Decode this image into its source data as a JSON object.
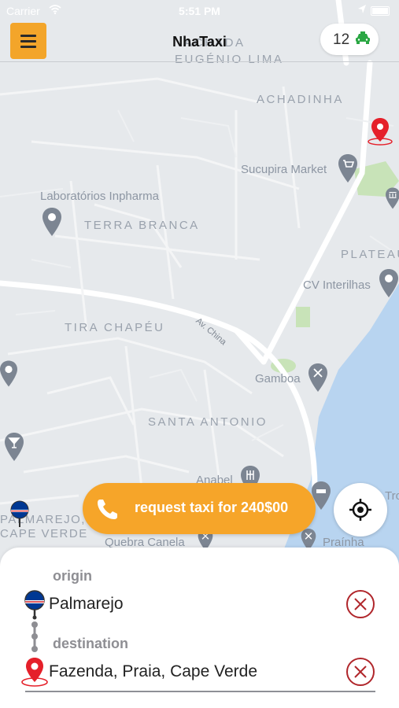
{
  "status_bar": {
    "carrier": "Carrier",
    "time": "5:51 PM"
  },
  "header": {
    "title": "NhaTaxi",
    "taxi_count": "12"
  },
  "map": {
    "district_labels": [
      "ACHADA",
      "EUGÉNIO LIMA",
      "ACHADINHA",
      "TERRA BRANCA",
      "PLATEAU",
      "TIRA CHAPÉU",
      "SANTA ANTONIO",
      "PALMAREJO,",
      "CAPE VERDE"
    ],
    "poi_labels": [
      "Sucupira Market",
      "Laboratórios Inpharma",
      "CV Interilhas",
      "Gamboa",
      "Anabel",
      "Quebra Canela",
      "Praínha",
      "Trop"
    ],
    "road_label": "Av. China"
  },
  "actions": {
    "request_label": "request taxi for 240$00"
  },
  "trip": {
    "origin_label": "origin",
    "origin_value": "Palmarejo",
    "destination_label": "destination",
    "destination_value": "Fazenda, Praia, Cape Verde"
  },
  "colors": {
    "accent": "#F6A529",
    "pin_red": "#E5202A",
    "clear_red": "#B0262B"
  }
}
